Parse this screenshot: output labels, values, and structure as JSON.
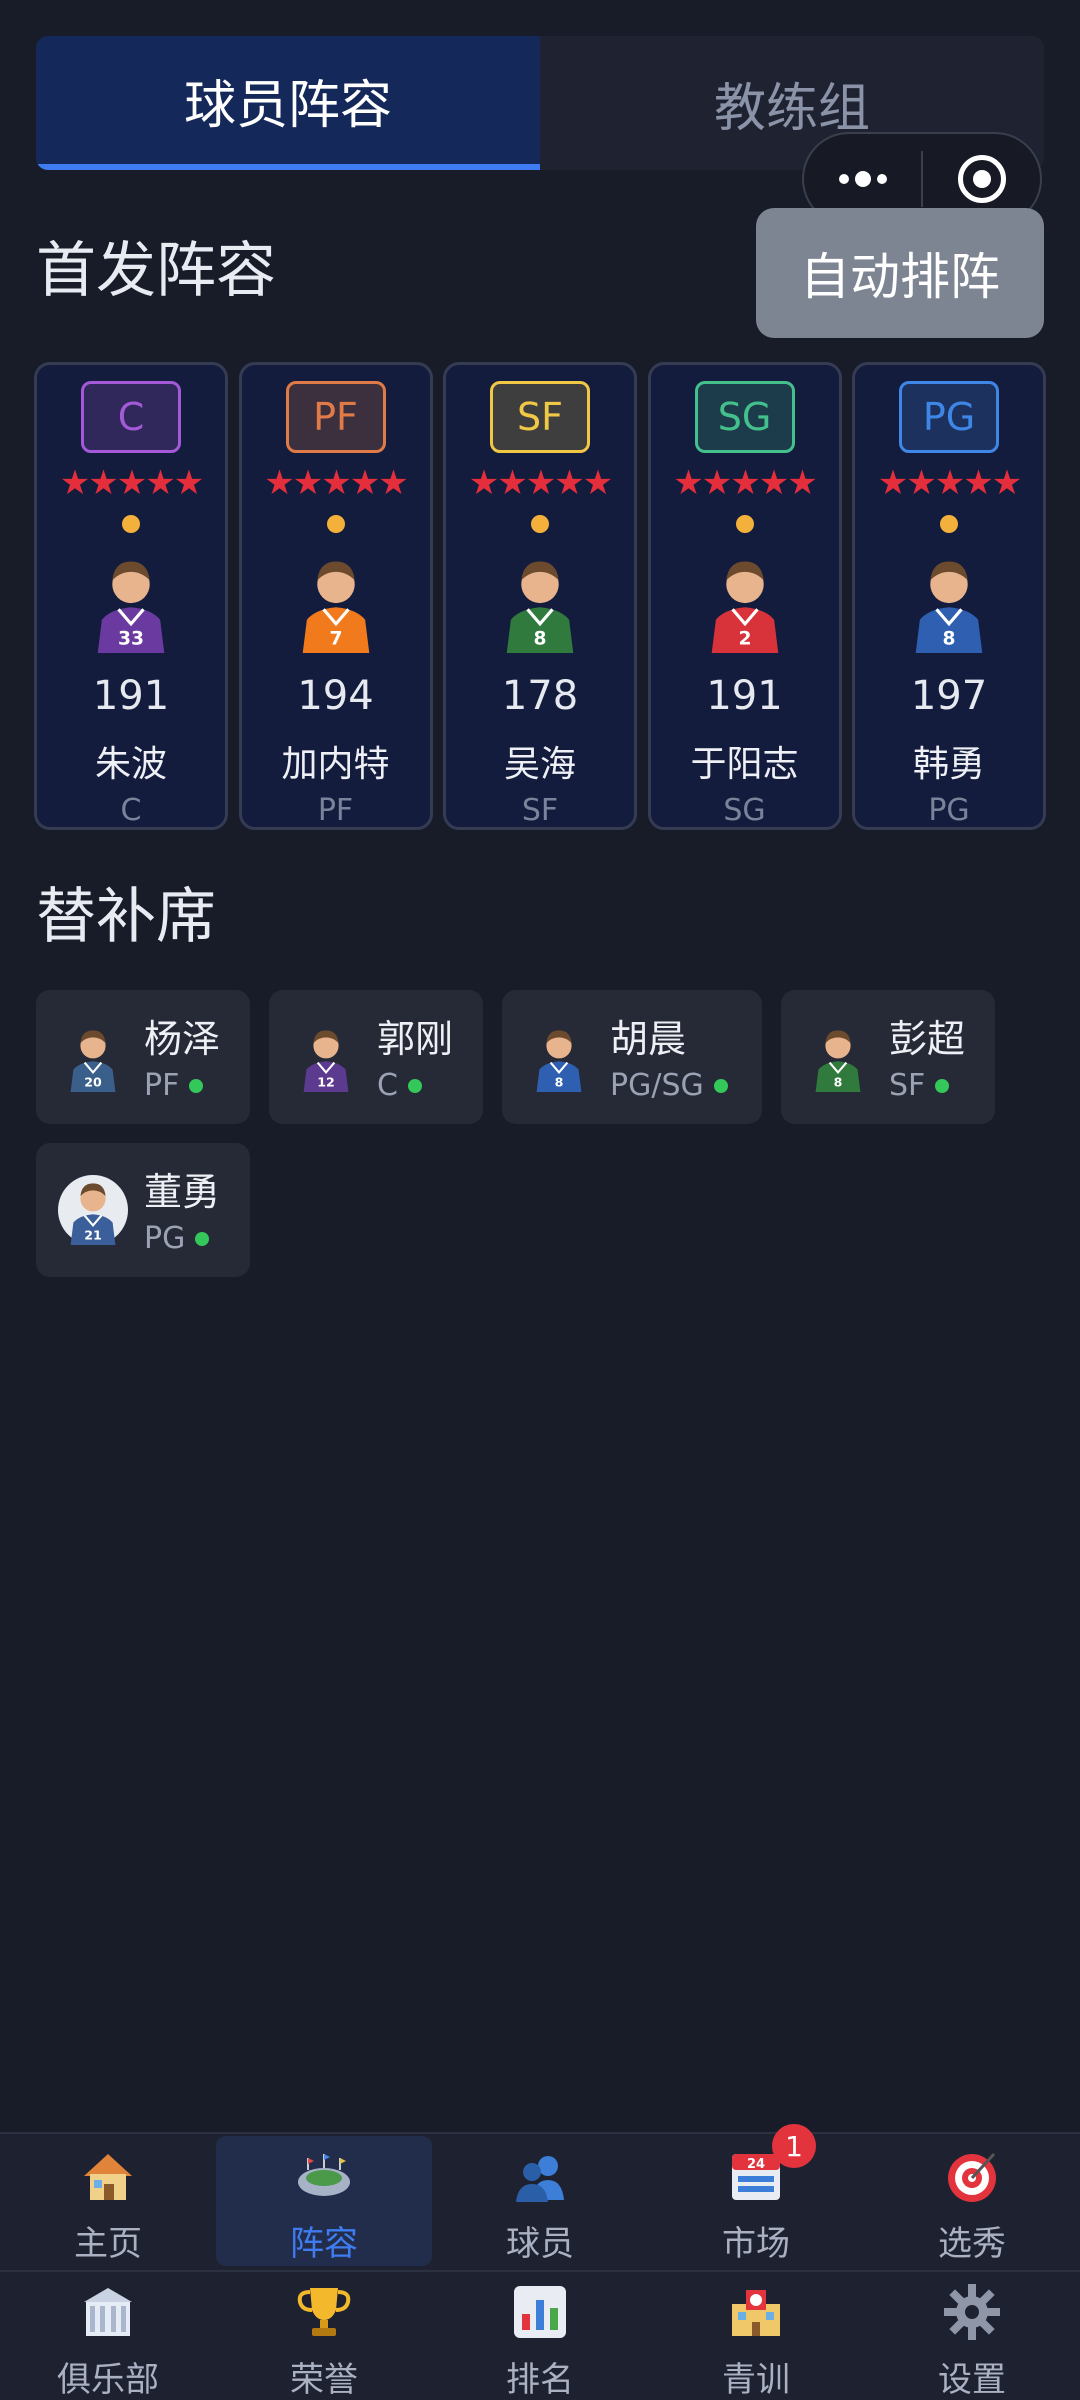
{
  "tabs": [
    {
      "label": "球员阵容",
      "active": true
    },
    {
      "label": "教练组",
      "active": false
    }
  ],
  "capsule": {
    "more_icon": "more-dots-icon",
    "close_icon": "target-icon"
  },
  "starting": {
    "title": "首发阵容",
    "auto_button": "自动排阵",
    "rating_stars": "★★★★★",
    "players": [
      {
        "badge": "C",
        "badge_color": "#a45ad8",
        "number": "191",
        "name": "朱波",
        "pos": "C",
        "jersey_color": "#6a3aa0",
        "jersey_number": "33"
      },
      {
        "badge": "PF",
        "badge_color": "#e07b48",
        "number": "194",
        "name": "加内特",
        "pos": "PF",
        "jersey_color": "#f07a1c",
        "jersey_number": "7"
      },
      {
        "badge": "SF",
        "badge_color": "#f0c845",
        "number": "178",
        "name": "吴海",
        "pos": "SF",
        "jersey_color": "#2f7a3c",
        "jersey_number": "8"
      },
      {
        "badge": "SG",
        "badge_color": "#43c08b",
        "number": "191",
        "name": "于阳志",
        "pos": "SG",
        "jersey_color": "#d8323a",
        "jersey_number": "2"
      },
      {
        "badge": "PG",
        "badge_color": "#3f87e6",
        "number": "197",
        "name": "韩勇",
        "pos": "PG",
        "jersey_color": "#2f5fb0",
        "jersey_number": "8"
      }
    ]
  },
  "bench": {
    "title": "替补席",
    "players": [
      {
        "name": "杨泽",
        "pos": "PF",
        "jersey_color": "#3a5f8a",
        "jersey_number": "20"
      },
      {
        "name": "郭刚",
        "pos": "C",
        "jersey_color": "#5b3a8f",
        "jersey_number": "12"
      },
      {
        "name": "胡晨",
        "pos": "PG/SG",
        "jersey_color": "#2f5fb0",
        "jersey_number": "8"
      },
      {
        "name": "彭超",
        "pos": "SF",
        "jersey_color": "#2f7a3c",
        "jersey_number": "8"
      },
      {
        "name": "董勇",
        "pos": "PG",
        "jersey_color": "#3a5f9a",
        "jersey_number": "21"
      }
    ]
  },
  "nav": {
    "row1": [
      {
        "label": "主页",
        "icon": "home-icon"
      },
      {
        "label": "阵容",
        "icon": "stadium-icon",
        "active": true
      },
      {
        "label": "球员",
        "icon": "players-icon"
      },
      {
        "label": "市场",
        "icon": "market-calendar-icon",
        "badge": "1"
      },
      {
        "label": "选秀",
        "icon": "draft-target-icon"
      }
    ],
    "row2": [
      {
        "label": "俱乐部",
        "icon": "club-building-icon"
      },
      {
        "label": "荣誉",
        "icon": "trophy-icon"
      },
      {
        "label": "排名",
        "icon": "ranking-chart-icon"
      },
      {
        "label": "青训",
        "icon": "academy-school-icon"
      },
      {
        "label": "设置",
        "icon": "gear-icon"
      }
    ]
  }
}
